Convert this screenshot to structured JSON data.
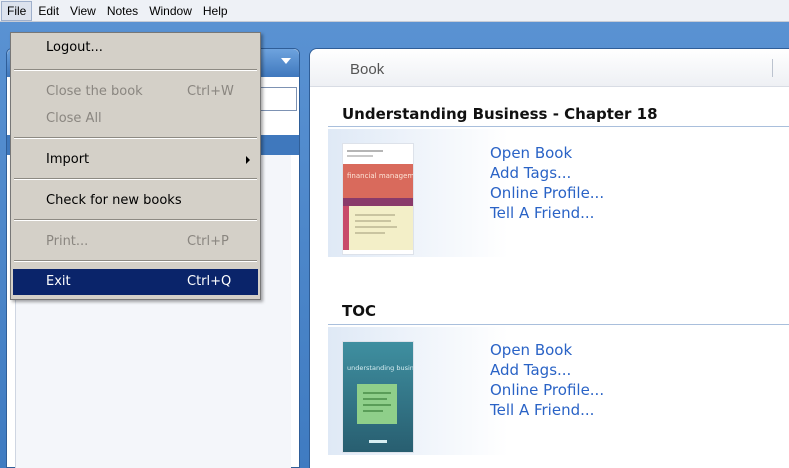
{
  "menubar": {
    "items": [
      "File",
      "Edit",
      "View",
      "Notes",
      "Window",
      "Help"
    ]
  },
  "file_menu": {
    "logout": "Logout...",
    "close_book": "Close the book",
    "close_book_shortcut": "Ctrl+W",
    "close_all": "Close All",
    "import": "Import",
    "check_books": "Check for new books",
    "print": "Print...",
    "print_shortcut": "Ctrl+P",
    "exit": "Exit",
    "exit_shortcut": "Ctrl+Q"
  },
  "main": {
    "tab_label": "Book",
    "books": [
      {
        "title": "Understanding Business - Chapter 18",
        "cover_text": "financial management",
        "actions": [
          "Open Book",
          "Add Tags...",
          "Online Profile...",
          "Tell A Friend..."
        ]
      },
      {
        "title": "TOC",
        "cover_text": "understanding business",
        "actions": [
          "Open Book",
          "Add Tags...",
          "Online Profile...",
          "Tell A Friend..."
        ]
      }
    ]
  },
  "colors": {
    "accent": "#3f78bd",
    "link": "#2a63c6",
    "menu_highlight": "#0a246a"
  }
}
